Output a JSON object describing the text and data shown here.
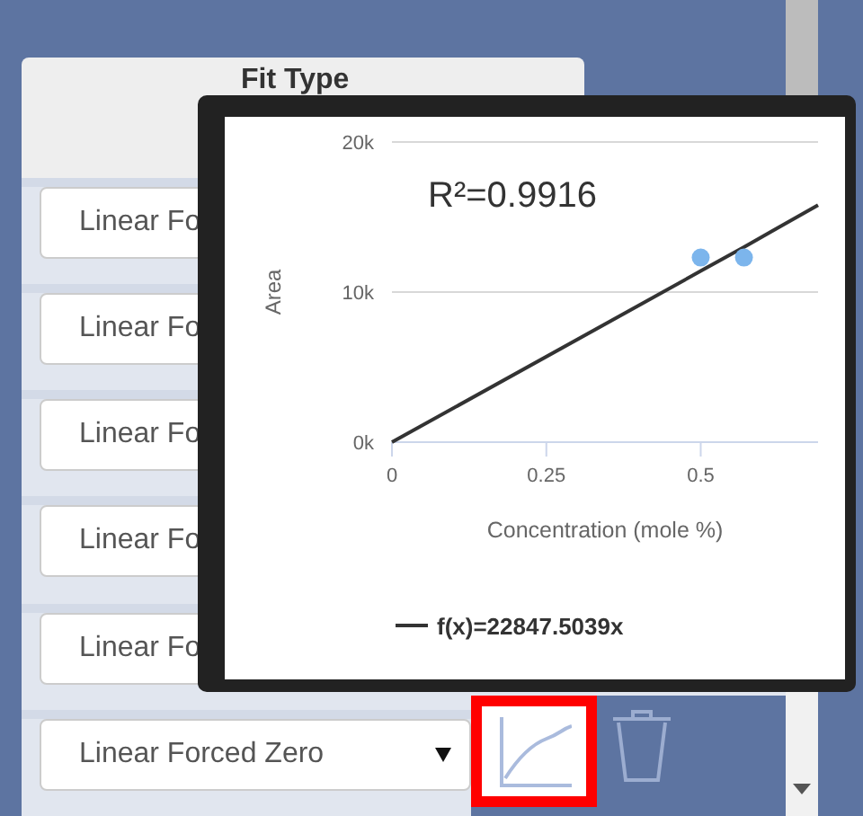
{
  "table": {
    "header": "Fit Type",
    "rows": [
      {
        "fit_type": "Linear Fo"
      },
      {
        "fit_type": "Linear Fo"
      },
      {
        "fit_type": "Linear Fo"
      },
      {
        "fit_type": "Linear Fo"
      },
      {
        "fit_type": "Linear Fo"
      },
      {
        "fit_type": "Linear Forced Zero",
        "highlighted": true
      }
    ]
  },
  "tooltip": {
    "chart_data": {
      "type": "line",
      "xlabel": "Concentration (mole %)",
      "ylabel": "Area",
      "x": [
        0,
        0.5,
        0.57,
        0.69
      ],
      "series": [
        {
          "name": "f(x)=22847.5039x",
          "color": "#333333",
          "values": [
            0,
            11400,
            13000,
            15800
          ]
        },
        {
          "type": "scatter",
          "color": "#7cb5ec",
          "values": [
            null,
            12300,
            12300,
            null
          ]
        }
      ],
      "xlim": [
        0,
        0.69
      ],
      "ylim": [
        0,
        20000
      ],
      "xticks": [
        0,
        0.25,
        0.5
      ],
      "yticks": [
        {
          "value": 0,
          "label": "0k"
        },
        {
          "value": 10000,
          "label": "10k"
        },
        {
          "value": 20000,
          "label": "20k"
        }
      ],
      "annotations": [
        {
          "text": "R²=0.9916"
        }
      ]
    }
  }
}
